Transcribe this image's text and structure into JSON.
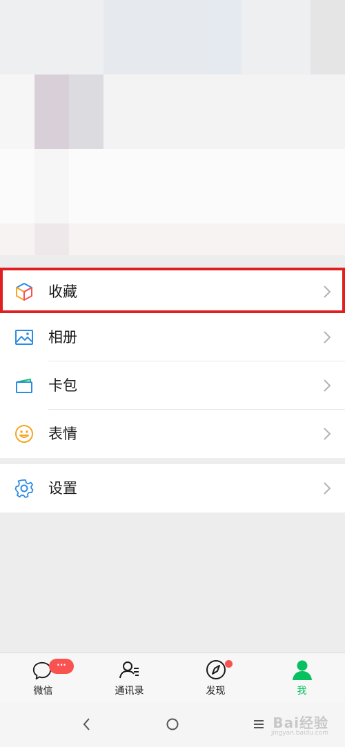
{
  "menu": {
    "favorites": {
      "label": "收藏",
      "icon": "cube-icon"
    },
    "album": {
      "label": "相册",
      "icon": "image-icon"
    },
    "cards": {
      "label": "卡包",
      "icon": "card-icon"
    },
    "stickers": {
      "label": "表情",
      "icon": "smiley-icon"
    },
    "settings": {
      "label": "设置",
      "icon": "gear-icon"
    }
  },
  "tabs": [
    {
      "label": "微信",
      "icon": "chat-bubble-icon",
      "badge": "···"
    },
    {
      "label": "通讯录",
      "icon": "contacts-icon"
    },
    {
      "label": "发现",
      "icon": "compass-icon"
    },
    {
      "label": "我",
      "icon": "person-icon",
      "active": true
    }
  ],
  "colors": {
    "accent_green": "#07c160",
    "badge_red": "#fa5151",
    "highlight_red": "#e02020",
    "icon_blue": "#2b8be6",
    "icon_orange": "#f5a623"
  },
  "watermark": {
    "text": "Bai经验",
    "sub": "jingyan.baidu.com"
  }
}
